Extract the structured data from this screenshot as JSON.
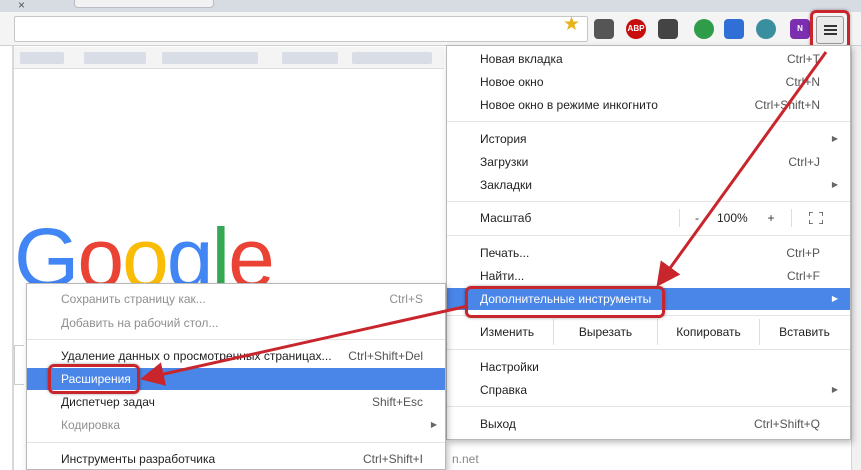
{
  "toolbar": {
    "extensions": [
      {
        "name": "pocket-icon",
        "color": "#555555",
        "label": ""
      },
      {
        "name": "abp-icon",
        "color": "#c70d0d",
        "label": "ABP"
      },
      {
        "name": "evernote-icon",
        "color": "#444444",
        "label": ""
      },
      {
        "name": "ext-green-icon",
        "color": "#2e9c48",
        "label": ""
      },
      {
        "name": "ext-blue-icon",
        "color": "#2f6fd6",
        "label": ""
      },
      {
        "name": "ext-teal-icon",
        "color": "#3a8f9f",
        "label": ""
      },
      {
        "name": "onenote-icon",
        "color": "#7b2fb0",
        "label": "N"
      }
    ],
    "menu_button_icon": "hamburger-icon"
  },
  "bottom_fragment": "n.net",
  "main_menu": {
    "new_tab": {
      "label": "Новая вкладка",
      "shortcut": "Ctrl+T"
    },
    "new_window": {
      "label": "Новое окно",
      "shortcut": "Ctrl+N"
    },
    "incognito": {
      "label": "Новое окно в режиме инкогнито",
      "shortcut": "Ctrl+Shift+N"
    },
    "history": {
      "label": "История"
    },
    "downloads": {
      "label": "Загрузки",
      "shortcut": "Ctrl+J"
    },
    "bookmarks": {
      "label": "Закладки"
    },
    "zoom": {
      "label": "Масштаб",
      "minus": "-",
      "value": "100%",
      "plus": "+"
    },
    "print": {
      "label": "Печать...",
      "shortcut": "Ctrl+P"
    },
    "find": {
      "label": "Найти...",
      "shortcut": "Ctrl+F"
    },
    "more_tools": {
      "label": "Дополнительные инструменты"
    },
    "edit": {
      "label": "Изменить",
      "cut": "Вырезать",
      "copy": "Копировать",
      "paste": "Вставить"
    },
    "settings": {
      "label": "Настройки"
    },
    "help": {
      "label": "Справка"
    },
    "exit": {
      "label": "Выход",
      "shortcut": "Ctrl+Shift+Q"
    }
  },
  "sub_menu": {
    "save_page": {
      "label": "Сохранить страницу как...",
      "shortcut": "Ctrl+S"
    },
    "add_to_desktop": {
      "label": "Добавить на рабочий стол..."
    },
    "clear_data": {
      "label": "Удаление данных о просмотренных страницах...",
      "shortcut": "Ctrl+Shift+Del"
    },
    "extensions": {
      "label": "Расширения"
    },
    "task_manager": {
      "label": "Диспетчер задач",
      "shortcut": "Shift+Esc"
    },
    "encoding": {
      "label": "Кодировка"
    },
    "dev_tools": {
      "label": "Инструменты разработчика",
      "shortcut": "Ctrl+Shift+I"
    }
  },
  "colors": {
    "highlight": "#c9252d",
    "selection": "#4a86e8"
  }
}
